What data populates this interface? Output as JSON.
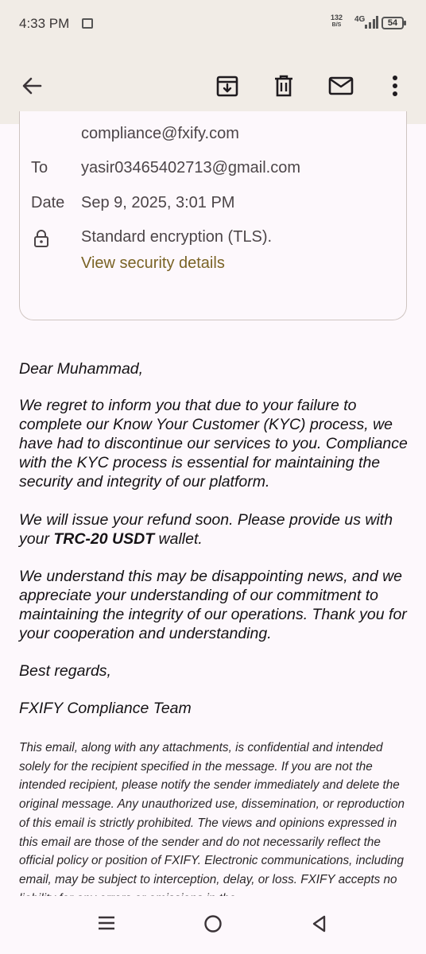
{
  "status_bar": {
    "time": "4:33 PM",
    "speed_value": "132",
    "speed_unit": "B/S",
    "network": "4G",
    "battery": "54"
  },
  "toolbar": {
    "back_icon": "arrow-left-icon",
    "archive_icon": "archive-icon",
    "delete_icon": "trash-icon",
    "mark_unread_icon": "mail-icon",
    "more_icon": "more-vert-icon"
  },
  "details": {
    "from_email": "compliance@fxify.com",
    "to_label": "To",
    "to_value": "yasir03465402713@gmail.com",
    "date_label": "Date",
    "date_value": "Sep 9, 2025, 3:01 PM",
    "encryption": "Standard encryption (TLS).",
    "security_link": "View security details"
  },
  "message": {
    "greeting": "Dear Muhammad,",
    "p1": "We regret to inform you that due to your failure to complete our Know Your Customer (KYC) process, we have had to discontinue our services to you. Compliance with the KYC process is essential for maintaining the security and integrity of our platform.",
    "p2_before": "We will issue your refund soon. Please provide us with your ",
    "p2_bold": "TRC-20 USDT",
    "p2_after": " wallet.",
    "p3": "We understand this may be disappointing news, and we appreciate your understanding of our commitment to maintaining the integrity of our operations. Thank you for your cooperation and understanding.",
    "closing": "Best regards,",
    "signature": "FXIFY Compliance Team",
    "disclaimer": "This email, along with any attachments, is confidential and intended solely for the recipient specified in the message. If you are not the intended recipient, please notify the sender immediately and delete the original message. Any unauthorized use, dissemination, or reproduction of this email is strictly prohibited. The views and opinions expressed in this email are those of the sender and do not necessarily reflect the official policy or position of FXIFY. Electronic communications, including email, may be subject to interception, delay, or loss. FXIFY accepts no liability for any errors or omissions in the"
  },
  "nav_bar": {
    "recents_icon": "menu-icon",
    "home_icon": "home-circle-icon",
    "back_icon": "triangle-back-icon"
  }
}
